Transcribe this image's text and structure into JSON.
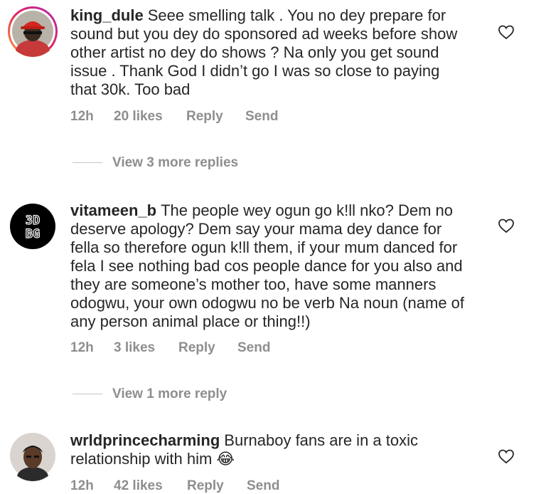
{
  "comments": [
    {
      "username": "king_dule",
      "text": "Seee smelling talk . You no dey prepare for sound but you dey do sponsored ad weeks before show other artist no dey do shows ? Na only you get sound issue . Thank God I didn’t go I was so close to paying that 30k. Too bad",
      "time": "12h",
      "likes": "20 likes",
      "reply": "Reply",
      "send": "Send",
      "view_replies": "View 3 more replies"
    },
    {
      "username": "vitameen_b",
      "text": "The people wey ogun go k!ll nko? Dem no deserve apology? Dem say your mama dey dance for fella so therefore ogun k!ll them, if your mum danced for fela I see nothing bad cos people dance for you also and they are someone’s mother too, have some manners odogwu, your own odogwu no be verb Na noun (name of any person animal place or thing!!)",
      "time": "12h",
      "likes": "3 likes",
      "reply": "Reply",
      "send": "Send",
      "view_replies": "View 1 more reply",
      "avatar_text": "3D BG"
    },
    {
      "username": "wrldprincecharming",
      "text": "Burnaboy fans are in a toxic relationship with him 😂",
      "time": "12h",
      "likes": "42 likes",
      "reply": "Reply",
      "send": "Send"
    }
  ],
  "colors": {
    "text": "#262626",
    "meta": "#8e8e8e",
    "divider": "#c7c7c7"
  }
}
